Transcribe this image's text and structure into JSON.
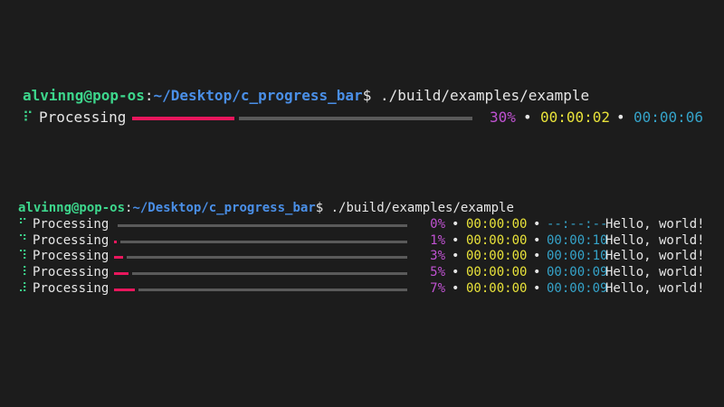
{
  "block1": {
    "prompt": {
      "user": "alvinng@pop-os",
      "colon": ":",
      "path": "~/Desktop/c_progress_bar",
      "dollar": "$",
      "command": " ./build/examples/example"
    },
    "progress": {
      "spinner": "⠏",
      "label": "Processing",
      "percent_value": 30,
      "percent_text": "30%",
      "bullet": "•",
      "elapsed": "00:00:02",
      "eta": "00:00:06"
    }
  },
  "block2": {
    "prompt": {
      "user": "alvinng@pop-os",
      "colon": ":",
      "path": "~/Desktop/c_progress_bar",
      "dollar": "$",
      "command": " ./build/examples/example"
    },
    "rows": [
      {
        "spinner": "⠋",
        "label": "Processing",
        "percent_value": 0,
        "percent_text": "0%",
        "bullet": "•",
        "elapsed": "00:00:00",
        "eta": "--:--:--",
        "message": "Hello, world!"
      },
      {
        "spinner": "⠙",
        "label": "Processing",
        "percent_value": 1,
        "percent_text": "1%",
        "bullet": "•",
        "elapsed": "00:00:00",
        "eta": "00:00:10",
        "message": "Hello, world!"
      },
      {
        "spinner": "⠹",
        "label": "Processing",
        "percent_value": 3,
        "percent_text": "3%",
        "bullet": "•",
        "elapsed": "00:00:00",
        "eta": "00:00:10",
        "message": "Hello, world!"
      },
      {
        "spinner": "⠸",
        "label": "Processing",
        "percent_value": 5,
        "percent_text": "5%",
        "bullet": "•",
        "elapsed": "00:00:00",
        "eta": "00:00:09",
        "message": "Hello, world!"
      },
      {
        "spinner": "⠼",
        "label": "Processing",
        "percent_value": 7,
        "percent_text": "7%",
        "bullet": "•",
        "elapsed": "00:00:00",
        "eta": "00:00:09",
        "message": "Hello, world!"
      }
    ]
  },
  "colors": {
    "background": "#1c1c1c",
    "user": "#3dd68c",
    "path": "#4a8fe7",
    "bar_done": "#e8175d",
    "bar_rest": "#5a5a5a",
    "percent": "#c052d2",
    "elapsed": "#e8e23a",
    "eta": "#35a3c9"
  }
}
